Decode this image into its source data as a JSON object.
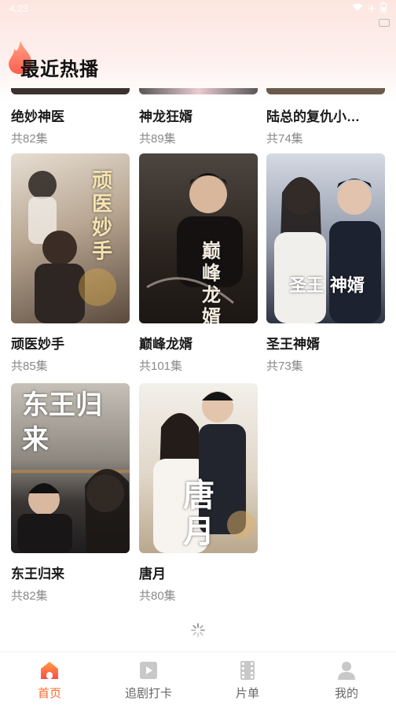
{
  "status_bar": {
    "time": "4:23"
  },
  "header": {
    "title": "最近热播"
  },
  "partial_row": [
    {
      "title": "绝妙神医",
      "episodes": "共82集"
    },
    {
      "title": "神龙狂婿",
      "episodes": "共89集"
    },
    {
      "title": "陆总的复仇小…",
      "episodes": "共74集"
    }
  ],
  "dramas": [
    {
      "title": "顽医妙手",
      "episodes": "共85集",
      "poster_text": "顽医妙手",
      "colors": [
        "#cfc2b4",
        "#7d6a58"
      ]
    },
    {
      "title": "巅峰龙婿",
      "episodes": "共101集",
      "poster_text": "巅峰龙婿",
      "colors": [
        "#5a5046",
        "#231c16"
      ]
    },
    {
      "title": "圣王神婿",
      "episodes": "共73集",
      "poster_text": "圣王 神婿",
      "colors": [
        "#c7ccd6",
        "#2e3340"
      ]
    },
    {
      "title": "东王归来",
      "episodes": "共82集",
      "poster_text": "东王归来",
      "colors": [
        "#b9b3aa",
        "#2b2a2c"
      ]
    },
    {
      "title": "唐月",
      "episodes": "共80集",
      "poster_text": "唐月",
      "colors": [
        "#e9e3d9",
        "#a89a86"
      ]
    }
  ],
  "tabbar": [
    {
      "label": "首页",
      "icon": "home-icon",
      "active": true
    },
    {
      "label": "追剧打卡",
      "icon": "play-icon",
      "active": false
    },
    {
      "label": "片单",
      "icon": "film-list-icon",
      "active": false
    },
    {
      "label": "我的",
      "icon": "profile-icon",
      "active": false
    }
  ],
  "colors": {
    "accent": "#ff6a2c",
    "title": "#1a1a1a",
    "subtitle": "#8a8a8a"
  }
}
